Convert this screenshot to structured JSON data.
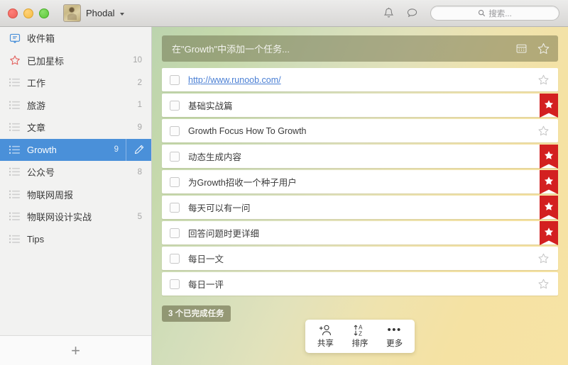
{
  "window": {
    "title": "Phodal",
    "traffic_lights": [
      "close",
      "minimize",
      "maximize"
    ]
  },
  "titlebar": {
    "profile_name": "Phodal",
    "notifications_icon": "bell-icon",
    "messages_icon": "chat-bubble-icon",
    "search": {
      "placeholder": "搜索...",
      "icon": "search-icon"
    }
  },
  "sidebar": {
    "items": [
      {
        "label": "收件箱",
        "count": "",
        "icon": "inbox-icon",
        "selected": false
      },
      {
        "label": "已加星标",
        "count": "10",
        "icon": "star-icon",
        "selected": false
      },
      {
        "label": "工作",
        "count": "2",
        "icon": "list-icon",
        "selected": false
      },
      {
        "label": "旅游",
        "count": "1",
        "icon": "list-icon",
        "selected": false
      },
      {
        "label": "文章",
        "count": "9",
        "icon": "list-icon",
        "selected": false
      },
      {
        "label": "Growth",
        "count": "9",
        "icon": "list-icon",
        "selected": true
      },
      {
        "label": "公众号",
        "count": "8",
        "icon": "list-icon",
        "selected": false
      },
      {
        "label": "物联网周报",
        "count": "",
        "icon": "list-icon",
        "selected": false
      },
      {
        "label": "物联网设计实战",
        "count": "5",
        "icon": "list-icon",
        "selected": false
      },
      {
        "label": "Tips",
        "count": "",
        "icon": "list-icon",
        "selected": false
      }
    ],
    "add_list_label": "+",
    "edit_icon": "pencil-icon",
    "accent_color": "#4a90d9"
  },
  "main": {
    "add_task": {
      "placeholder": "在\"Growth\"中添加一个任务...",
      "calendar_icon": "calendar-icon",
      "star_icon": "star-outline-icon"
    },
    "tasks": [
      {
        "text": "http://www.runoob.com/",
        "is_link": true,
        "starred": false,
        "checked": false
      },
      {
        "text": "基础实战篇",
        "is_link": false,
        "starred": true,
        "checked": false
      },
      {
        "text": "Growth Focus How To Growth",
        "is_link": false,
        "starred": false,
        "checked": false
      },
      {
        "text": "动态生成内容",
        "is_link": false,
        "starred": true,
        "checked": false
      },
      {
        "text": "为Growth招收一个种子用户",
        "is_link": false,
        "starred": true,
        "checked": false
      },
      {
        "text": "每天可以有一问",
        "is_link": false,
        "starred": true,
        "checked": false
      },
      {
        "text": "回答问题时更详细",
        "is_link": false,
        "starred": true,
        "checked": false
      },
      {
        "text": "每日一文",
        "is_link": false,
        "starred": false,
        "checked": false
      },
      {
        "text": "每日一评",
        "is_link": false,
        "starred": false,
        "checked": false
      }
    ],
    "completed_badge": "3 个已完成任务",
    "ribbon_color": "#d32020",
    "link_color": "#4a7fd4"
  },
  "bottom_toolbar": {
    "buttons": [
      {
        "label": "共享",
        "icon": "add-person-icon"
      },
      {
        "label": "排序",
        "icon": "sort-az-icon"
      },
      {
        "label": "更多",
        "icon": "ellipsis-icon"
      }
    ]
  }
}
